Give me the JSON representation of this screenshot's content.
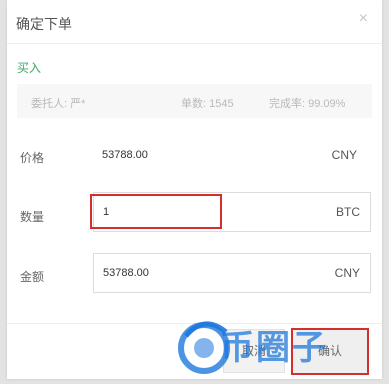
{
  "dialog": {
    "title": "确定下单",
    "close_glyph": "×"
  },
  "order": {
    "side": "买入",
    "info": {
      "principal": "委托人: 严*",
      "trades": "单数: 1545",
      "completion": "完成率: 99.09%"
    },
    "price": {
      "label": "价格",
      "value": "53788.00",
      "unit": "CNY"
    },
    "quantity": {
      "label": "数量",
      "value": "1",
      "unit": "BTC"
    },
    "amount": {
      "label": "金额",
      "value": "53788.00",
      "unit": "CNY"
    }
  },
  "footer": {
    "cancel_label": "取消",
    "confirm_label": "确认"
  },
  "watermark": {
    "text": "币圈子"
  },
  "colors": {
    "buy_green": "#3fa56a",
    "annotation_red": "#d32f2f",
    "watermark_blue": "#1e78dc"
  }
}
